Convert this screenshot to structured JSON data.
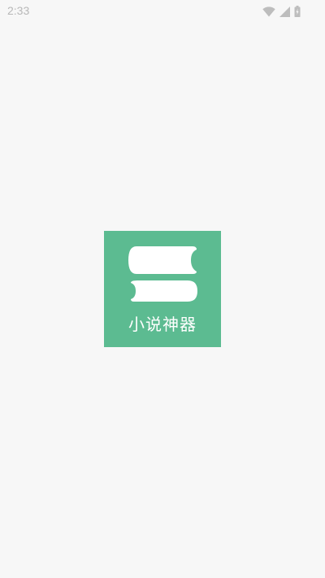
{
  "status_bar": {
    "time": "2:33",
    "icons": [
      "wifi-icon",
      "cellular-signal-icon",
      "battery-icon"
    ]
  },
  "splash": {
    "app_name": "小说神器",
    "colors": {
      "logo_background": "#5cbb91",
      "logo_foreground": "#ffffff",
      "page_background": "#f7f7f7"
    }
  }
}
